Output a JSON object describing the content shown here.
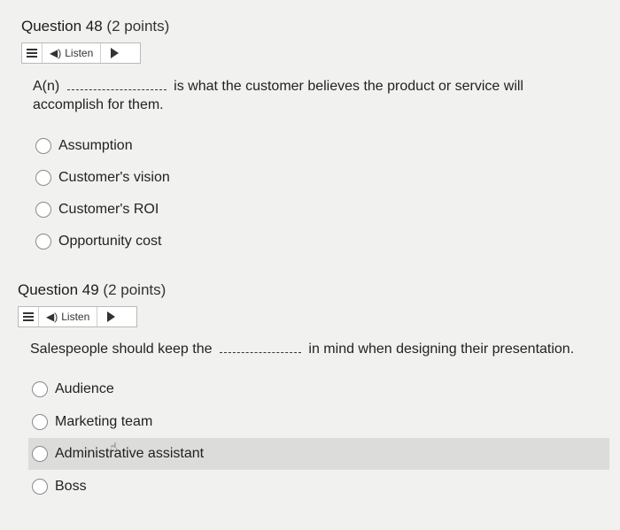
{
  "q48": {
    "title": "Question 48",
    "points": "(2 points)",
    "listen_label": "Listen",
    "stem_prefix": "A(n)",
    "stem_suffix": "is what the customer believes the product or service will",
    "stem_line2": "accomplish for them.",
    "options": [
      "Assumption",
      "Customer's vision",
      "Customer's ROI",
      "Opportunity cost"
    ]
  },
  "q49": {
    "title": "Question 49",
    "points": "(2 points)",
    "listen_label": "Listen",
    "stem_prefix": "Salespeople should keep the",
    "stem_suffix": "in mind when designing their presentation.",
    "options": [
      "Audience",
      "Marketing team",
      "Administrative assistant",
      "Boss"
    ]
  },
  "icons": {
    "menu": "menu-icon",
    "speaker": "speaker-icon",
    "play": "play-icon",
    "cursor": "hand-cursor-icon"
  }
}
